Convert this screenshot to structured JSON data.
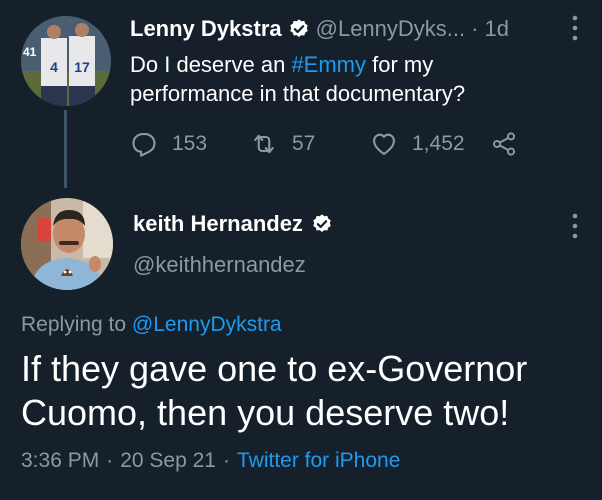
{
  "tweet1": {
    "author_name": "Lenny Dykstra",
    "author_handle": "@LennyDyks...",
    "separator": "·",
    "age": "1d",
    "text_pre": "Do I deserve an ",
    "hashtag": "#Emmy",
    "text_post1": " for my",
    "text_post2": "performance in that documentary?",
    "replies": "153",
    "retweets": "57",
    "likes": "1,452"
  },
  "tweet2": {
    "author_name": "keith Hernandez",
    "author_handle": "@keithhernandez",
    "replying_prefix": "Replying to ",
    "replying_handle": "@LennyDykstra",
    "text_line1": "If they gave one to ex-Governor",
    "text_line2": "Cuomo, then you deserve two!",
    "time": "3:36 PM",
    "dot1": "·",
    "date": "20 Sep 21",
    "dot2": "·",
    "source": "Twitter for iPhone"
  },
  "colors": {
    "background": "#15202b",
    "link": "#1d9bf0",
    "muted": "#8b98a5",
    "thread_line": "#3d5466"
  },
  "icons": [
    "verified-badge-icon",
    "reply-icon",
    "retweet-icon",
    "like-icon",
    "share-icon",
    "more-icon"
  ]
}
